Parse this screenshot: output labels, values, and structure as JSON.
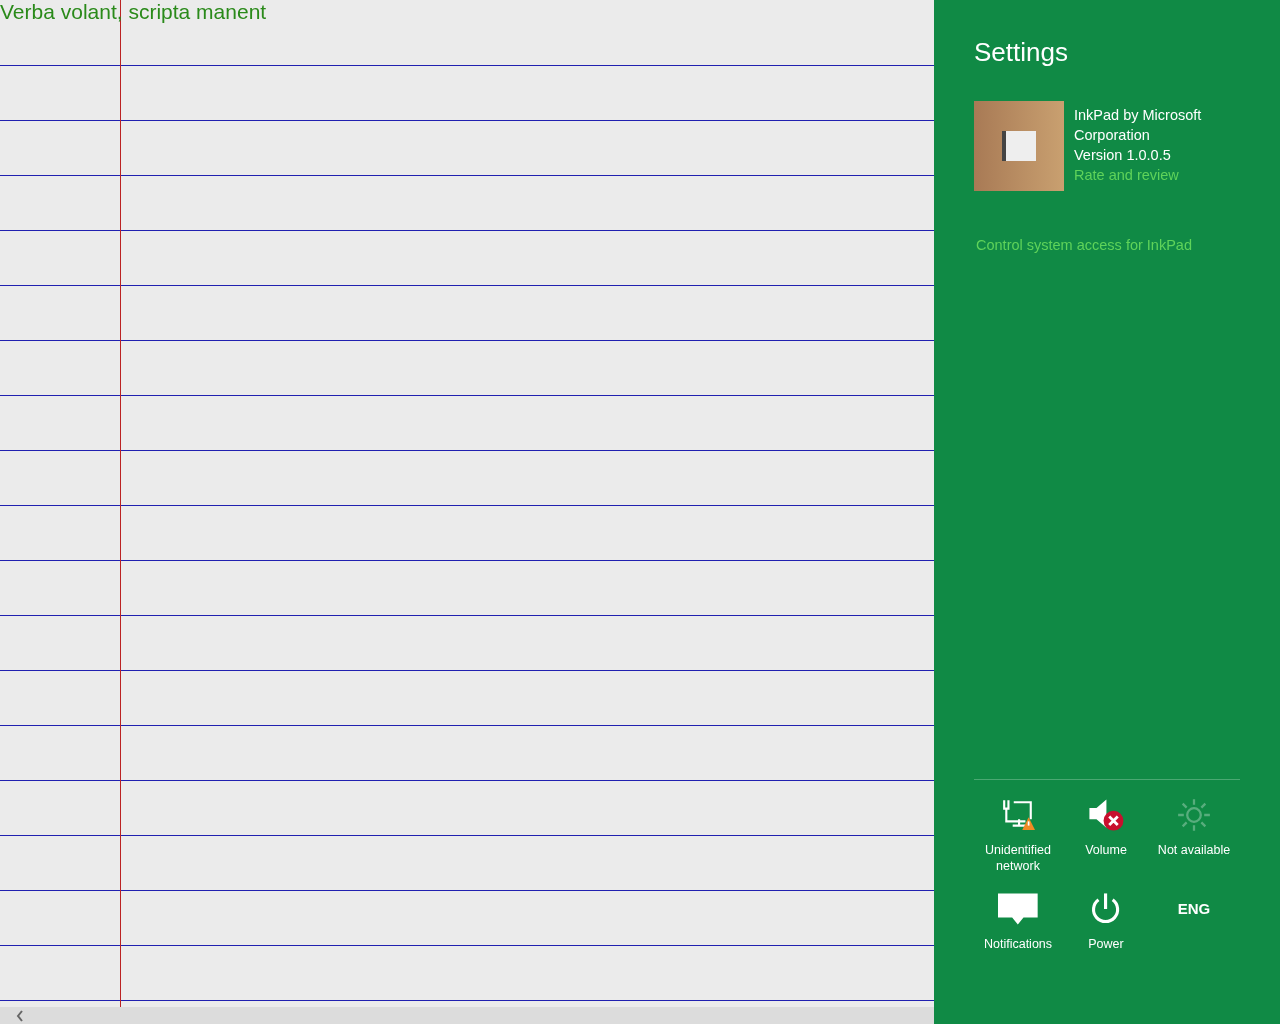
{
  "notebook": {
    "text": "Verba volant, scripta manent"
  },
  "settings": {
    "title": "Settings",
    "app": {
      "name": "InkPad by Microsoft Corporation",
      "version": "Version 1.0.0.5",
      "link": "Rate and review"
    },
    "permissions_link": "Control system access for InkPad",
    "quick_settings": [
      {
        "kind": "network",
        "label": "Unidentified network",
        "disabled": false
      },
      {
        "kind": "volume",
        "label": "Volume",
        "disabled": false
      },
      {
        "kind": "brightness",
        "label": "Not available",
        "disabled": true
      },
      {
        "kind": "notifications",
        "label": "Notifications",
        "disabled": false
      },
      {
        "kind": "power",
        "label": "Power",
        "disabled": false
      },
      {
        "kind": "keyboard",
        "label": "ENG",
        "disabled": false
      }
    ]
  }
}
